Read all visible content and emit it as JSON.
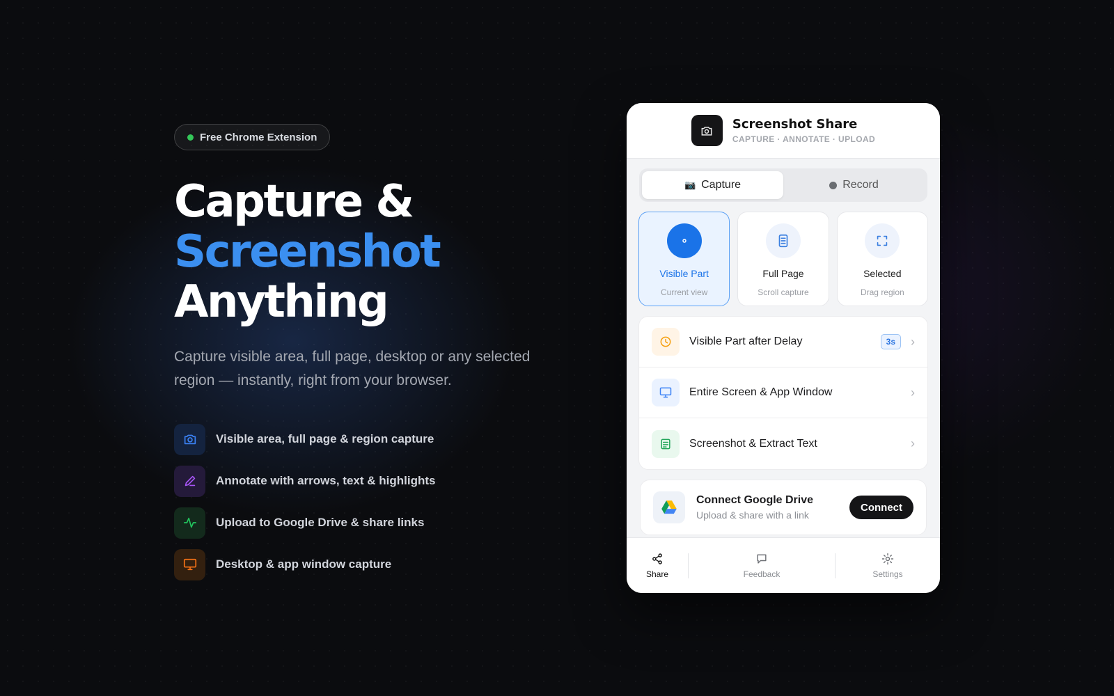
{
  "hero": {
    "badge": "Free Chrome Extension",
    "headline_1": "Capture &",
    "headline_2": "Screenshot",
    "headline_3": "Anything",
    "subtitle": "Capture visible area, full page, desktop or any selected region — instantly, right from your browser.",
    "features": [
      {
        "label": "Visible area, full page & region capture",
        "icon": "camera-icon",
        "color": "#3b82f6"
      },
      {
        "label": "Annotate with arrows, text & highlights",
        "icon": "pen-icon",
        "color": "#a855f7"
      },
      {
        "label": "Upload to Google Drive & share links",
        "icon": "activity-icon",
        "color": "#22c55e"
      },
      {
        "label": "Desktop & app window capture",
        "icon": "monitor-icon",
        "color": "#f97316"
      }
    ]
  },
  "popup": {
    "title": "Screenshot Share",
    "subtitle": "CAPTURE · ANNOTATE · UPLOAD",
    "tabs": [
      {
        "label": "Capture",
        "glyph": "📷",
        "active": true
      },
      {
        "label": "Record",
        "active": false
      }
    ],
    "modes": [
      {
        "label": "Visible Part",
        "sub": "Current view",
        "icon": "target-icon",
        "active": true
      },
      {
        "label": "Full Page",
        "sub": "Scroll capture",
        "icon": "document-icon",
        "active": false
      },
      {
        "label": "Selected",
        "sub": "Drag region",
        "icon": "crop-corners-icon",
        "active": false
      }
    ],
    "actions": [
      {
        "label": "Visible Part after Delay",
        "icon": "clock-icon",
        "badge": "3s"
      },
      {
        "label": "Entire Screen & App Window",
        "icon": "monitor-icon"
      },
      {
        "label": "Screenshot & Extract Text",
        "icon": "text-doc-icon"
      }
    ],
    "drive": {
      "title": "Connect Google Drive",
      "subtitle": "Upload & share with a link",
      "button": "Connect"
    },
    "footer": [
      {
        "label": "Share",
        "icon": "share-icon",
        "active": true
      },
      {
        "label": "Feedback",
        "icon": "chat-icon",
        "active": false
      },
      {
        "label": "Settings",
        "icon": "gear-icon",
        "active": false
      }
    ],
    "chevron": "›"
  }
}
